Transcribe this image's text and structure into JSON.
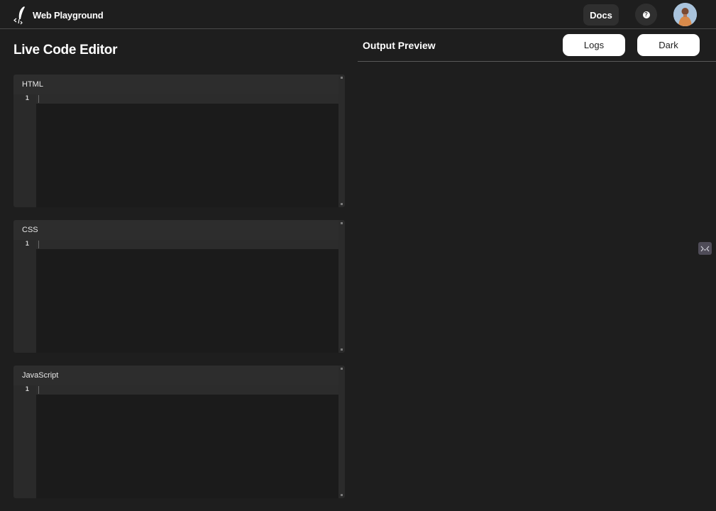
{
  "app": {
    "name": "Web Playground",
    "docs_label": "Docs",
    "help_icon": "question-mark-icon",
    "avatar_icon": "user-avatar"
  },
  "editor_section": {
    "title": "Live Code Editor",
    "panels": [
      {
        "label": "HTML",
        "line_number": "1"
      },
      {
        "label": "CSS",
        "line_number": "1"
      },
      {
        "label": "JavaScript",
        "line_number": "1"
      }
    ]
  },
  "output": {
    "title": "Output Preview",
    "logs_label": "Logs",
    "theme_label": "Dark"
  },
  "colors": {
    "background": "#1e1e1e",
    "panel_header": "#2d2d2d",
    "gutter": "#2a2a2a",
    "button_bg": "#ffffff"
  }
}
